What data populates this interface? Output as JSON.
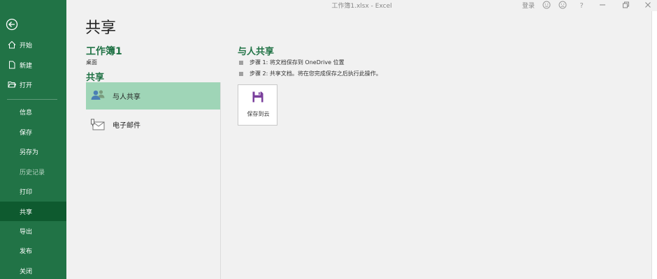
{
  "window": {
    "title": "工作簿1.xlsx  -  Excel",
    "signin": "登录"
  },
  "sidebar": {
    "items": [
      {
        "label": "开始",
        "icon": "home-icon"
      },
      {
        "label": "新建",
        "icon": "new-document-icon"
      },
      {
        "label": "打开",
        "icon": "open-folder-icon"
      },
      {
        "label": "信息"
      },
      {
        "label": "保存"
      },
      {
        "label": "另存为"
      },
      {
        "label": "历史记录"
      },
      {
        "label": "打印"
      },
      {
        "label": "共享"
      },
      {
        "label": "导出"
      },
      {
        "label": "发布"
      },
      {
        "label": "关闭"
      }
    ],
    "active": "共享",
    "color": "#217346",
    "active_color": "#0e5a2f"
  },
  "main": {
    "page_title": "共享",
    "workbook_name": "工作簿1",
    "workbook_location": "桌面",
    "share_heading": "共享",
    "options": [
      {
        "label": "与人共享",
        "icon": "share-people-icon",
        "selected": true
      },
      {
        "label": "电子邮件",
        "icon": "email-icon",
        "selected": false
      }
    ],
    "selected_color": "#9fd5b7"
  },
  "right_panel": {
    "title": "与人共享",
    "steps": [
      "步骤 1: 将文档保存到 OneDrive 位置",
      "步骤 2: 共享文档。将在您完成保存之后执行此操作。"
    ],
    "save_button": {
      "label": "保存到云",
      "icon": "save-disk-icon",
      "icon_color": "#7a3f9c"
    }
  }
}
